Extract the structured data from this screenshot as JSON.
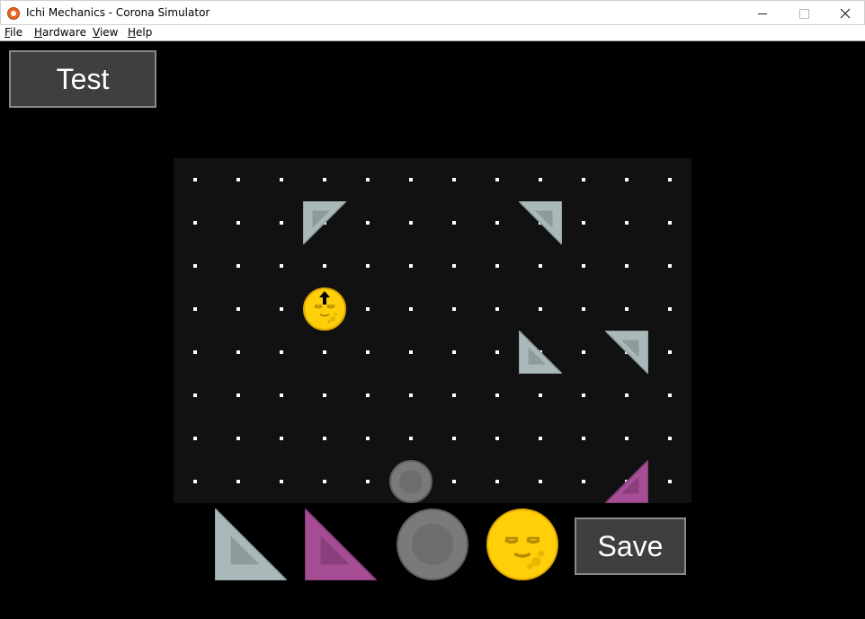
{
  "window": {
    "title": "Ichi Mechanics - Corona Simulator",
    "minimize_glyph": "—",
    "maximize_glyph": "☐",
    "close_glyph": "✕"
  },
  "menu": {
    "items": [
      {
        "id": "file",
        "underline": "F",
        "rest": "ile"
      },
      {
        "id": "hardware",
        "underline": "H",
        "rest": "ardware"
      },
      {
        "id": "view",
        "underline": "V",
        "rest": "iew"
      },
      {
        "id": "help",
        "underline": "H",
        "rest": "elp"
      }
    ]
  },
  "toolbar": {
    "test_label": "Test",
    "save_label": "Save"
  },
  "colors": {
    "board_bg": "#111111",
    "triangle_grey": "#a9b8b8",
    "triangle_grey_inner": "#8c9c9c",
    "triangle_purple": "#a64d95",
    "triangle_purple_inner": "#8a3f7c",
    "ball_grey": "#7a7a7a",
    "smiley_yellow": "#ffd00a",
    "button_bg": "#3f3f3f"
  },
  "board": {
    "columns": 12,
    "rows": 8,
    "pieces": [
      {
        "type": "triangle",
        "color": "grey",
        "corner": "top-left",
        "col": 3,
        "row": 1
      },
      {
        "type": "triangle",
        "color": "grey",
        "corner": "top-right",
        "col": 8,
        "row": 1
      },
      {
        "type": "smiley",
        "arrow": "up",
        "col": 3,
        "row": 3
      },
      {
        "type": "triangle",
        "color": "grey",
        "corner": "bottom-left",
        "col": 8,
        "row": 4
      },
      {
        "type": "triangle",
        "color": "grey",
        "corner": "top-right",
        "col": 10,
        "row": 4
      },
      {
        "type": "ball",
        "col": 5,
        "row": 7
      },
      {
        "type": "triangle",
        "color": "purple",
        "corner": "bottom-right",
        "col": 10,
        "row": 7
      }
    ]
  },
  "palette": [
    {
      "type": "triangle",
      "color": "grey",
      "corner": "bottom-left"
    },
    {
      "type": "triangle",
      "color": "purple",
      "corner": "bottom-left"
    },
    {
      "type": "ball"
    },
    {
      "type": "smiley"
    }
  ]
}
